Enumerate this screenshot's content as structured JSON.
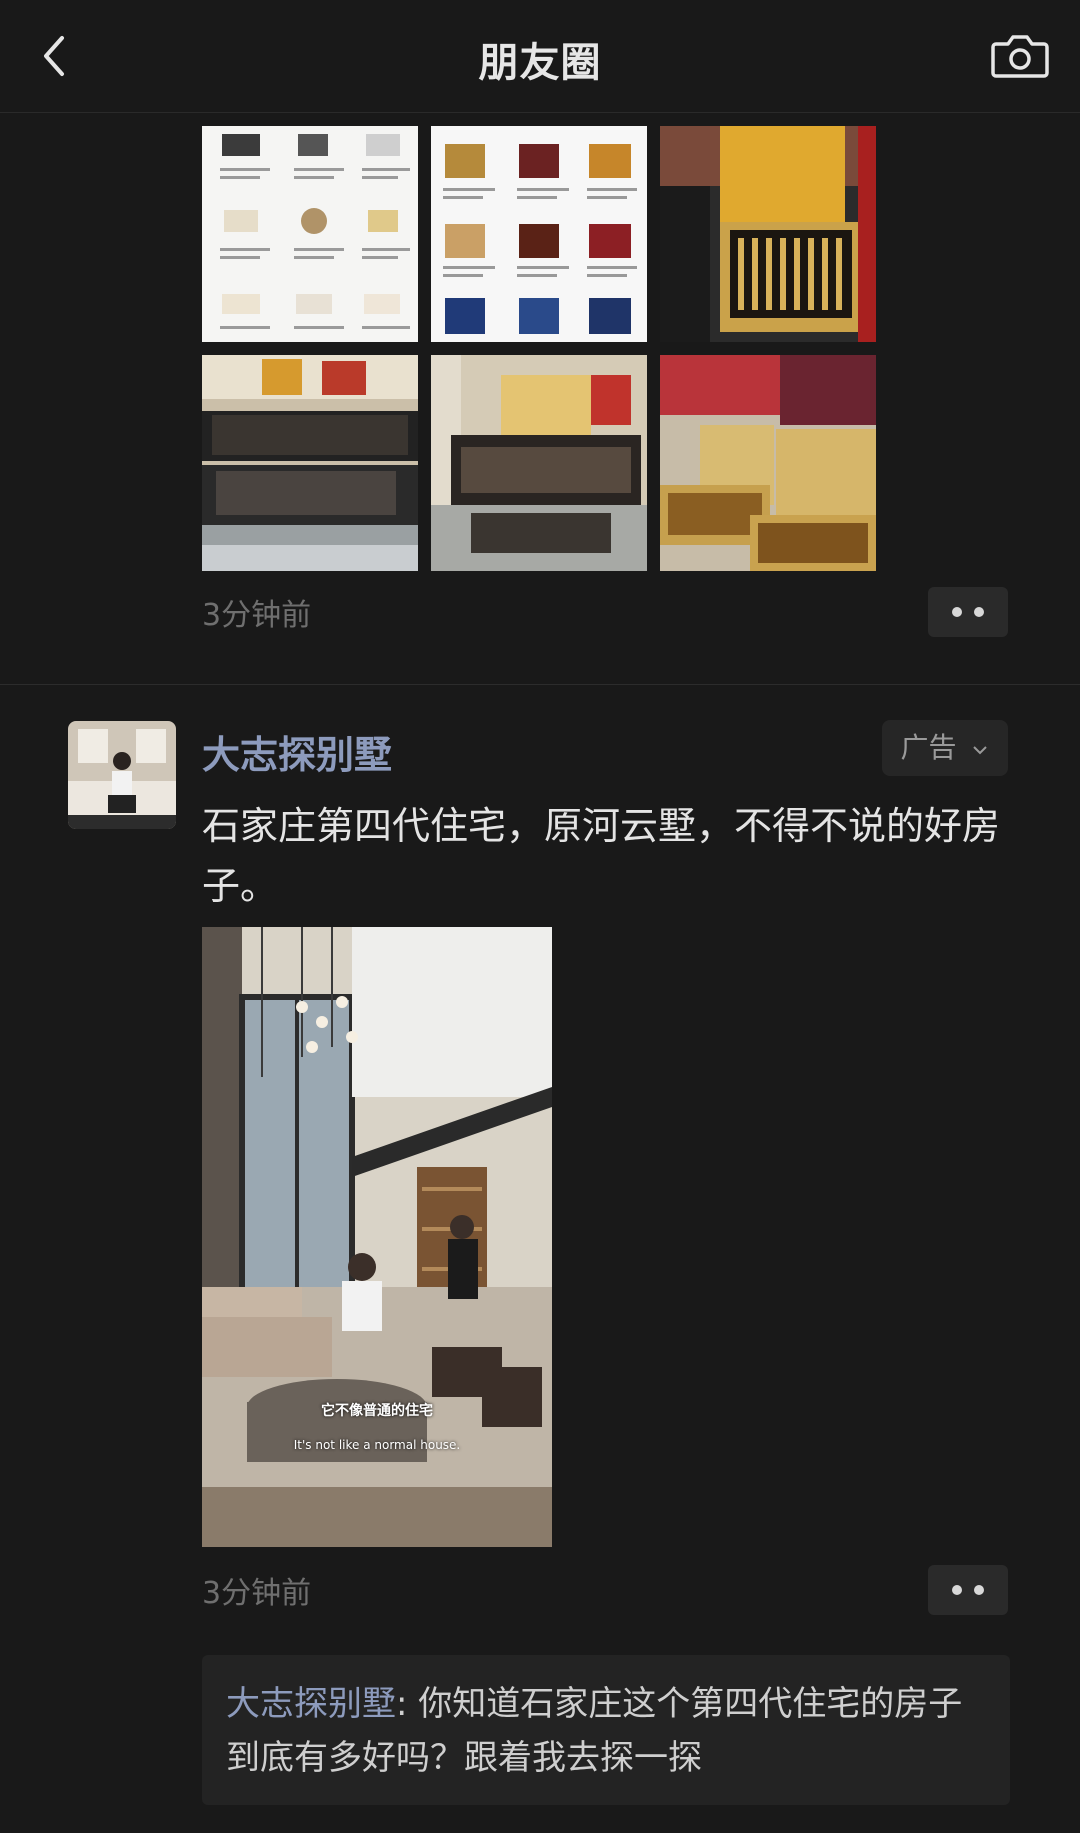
{
  "header": {
    "title": "朋友圈",
    "back_icon": "chevron-left-icon",
    "camera_icon": "camera-icon"
  },
  "post1": {
    "images": [
      {
        "alt": "product-catalog-white-1"
      },
      {
        "alt": "product-catalog-white-2"
      },
      {
        "alt": "gold-gift-box"
      },
      {
        "alt": "store-shelf-boxes-1"
      },
      {
        "alt": "store-shelf-boxes-2"
      },
      {
        "alt": "open-gift-boxes"
      }
    ],
    "time": "3分钟前"
  },
  "post2": {
    "author": "大志探别墅",
    "ad_label": "广告",
    "content": "石家庄第四代住宅，原河云墅，不得不说的好房子。",
    "video": {
      "subtitle_cn": "它不像普通的住宅",
      "subtitle_en": "It's not like a normal house."
    },
    "time": "3分钟前",
    "comment": {
      "author": "大志探别墅",
      "separator": ": ",
      "text": "你知道石家庄这个第四代住宅的房子到底有多好吗？跟着我去探一探"
    }
  },
  "colors": {
    "background": "#191919",
    "author_name": "#8d9bbd",
    "text": "#e4e4e4",
    "timestamp": "#6f6f6f"
  }
}
